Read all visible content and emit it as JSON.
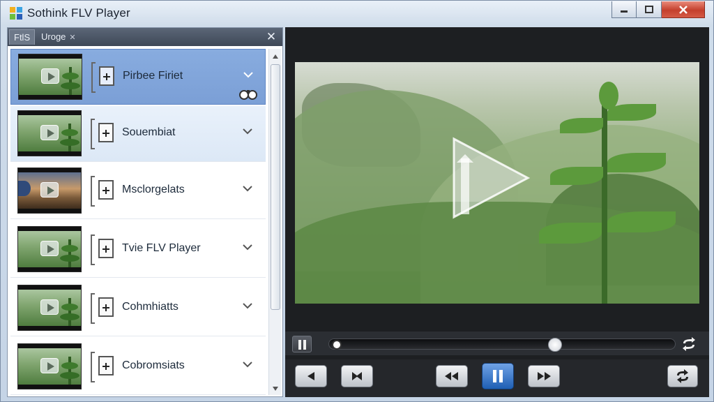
{
  "window": {
    "title": "Sothink FLV Player",
    "controls": [
      "minimize",
      "maximize",
      "close"
    ]
  },
  "sidebar": {
    "tabs": [
      {
        "label": "FtlS",
        "active": true
      },
      {
        "label": "Uroge",
        "closable": true
      }
    ],
    "items": [
      {
        "label": "Pirbee Firiet",
        "thumbnail": "green-hills",
        "selected": true,
        "badge": "binoculars-icon"
      },
      {
        "label": "Souembiat",
        "thumbnail": "green-hills",
        "selected": false
      },
      {
        "label": "Msclorgelats",
        "thumbnail": "sunset-landscape",
        "selected": false
      },
      {
        "label": "Tvie FLV Player",
        "thumbnail": "green-hills",
        "selected": false
      },
      {
        "label": "Cohmhiatts",
        "thumbnail": "green-hills",
        "selected": false
      },
      {
        "label": "Cobromsiats",
        "thumbnail": "green-hills",
        "selected": false
      }
    ]
  },
  "player": {
    "state": "paused",
    "progress": 0.66,
    "buttons": [
      "previous",
      "next-frame",
      "rewind",
      "pause",
      "fast-forward",
      "repeat"
    ]
  },
  "colors": {
    "selection": "#7b9fd6",
    "play_button": "#1f5fb4",
    "close_button": "#c4402d"
  }
}
